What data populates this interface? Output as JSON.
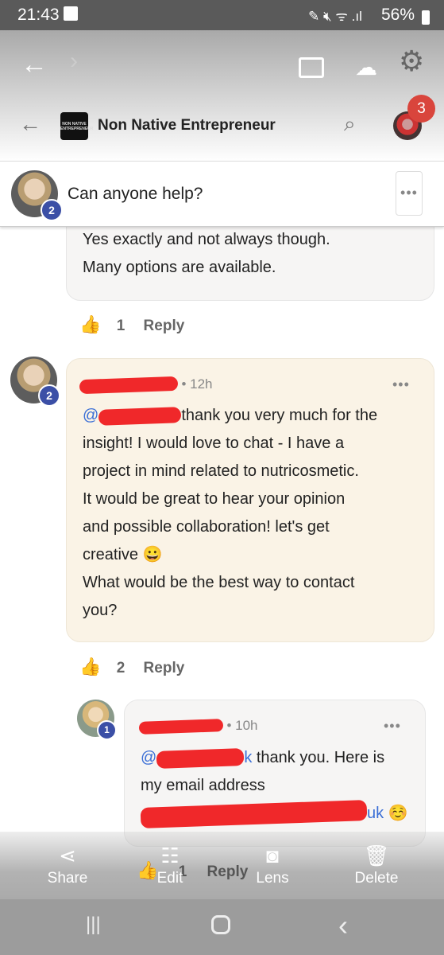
{
  "status_bar": {
    "time": "21:43",
    "battery": "56%"
  },
  "gallery_toolbar": {
    "icons": [
      "back-arrow",
      "forward-chevron",
      "cast",
      "cloud-upload",
      "settings-gear"
    ]
  },
  "group_header": {
    "title": "Non Native Entrepreneur",
    "logo_text": "NON NATIVE ENTREPRENEUR",
    "notification_count": "3"
  },
  "post": {
    "title": "Can anyone help?",
    "author_badge": "2",
    "more": "•••"
  },
  "comments": [
    {
      "lines": [
        "Yes exactly and not always though.",
        "Many options are available."
      ],
      "likes": "1",
      "reply": "Reply"
    },
    {
      "badge": "2",
      "time": "• 12h",
      "mention": "@",
      "lines": [
        "thank you very much for the",
        "insight! I would love to chat - I have a",
        "project in mind related to nutricosmetic.",
        "It would be great to hear your opinion",
        "and possible collaboration! let's get",
        "creative 😀",
        "What would be the best way to contact",
        "you?"
      ],
      "likes": "2",
      "reply": "Reply",
      "more": "•••",
      "bg": "#faf3e6"
    },
    {
      "badge": "1",
      "time": "• 10h",
      "mention": "@",
      "mention_tail": "k",
      "lines": [
        "thank you. Here is",
        "my email address"
      ],
      "email_tail": "uk",
      "emoji": "☺️",
      "likes": "1",
      "reply": "Reply",
      "more": "•••"
    }
  ],
  "bottom_actions": [
    {
      "label": "Share",
      "icon": "share"
    },
    {
      "label": "Edit",
      "icon": "sliders"
    },
    {
      "label": "Lens",
      "icon": "lens"
    },
    {
      "label": "Delete",
      "icon": "trash"
    }
  ],
  "nav": {
    "recent": "|||",
    "home": "○",
    "back": "‹"
  }
}
